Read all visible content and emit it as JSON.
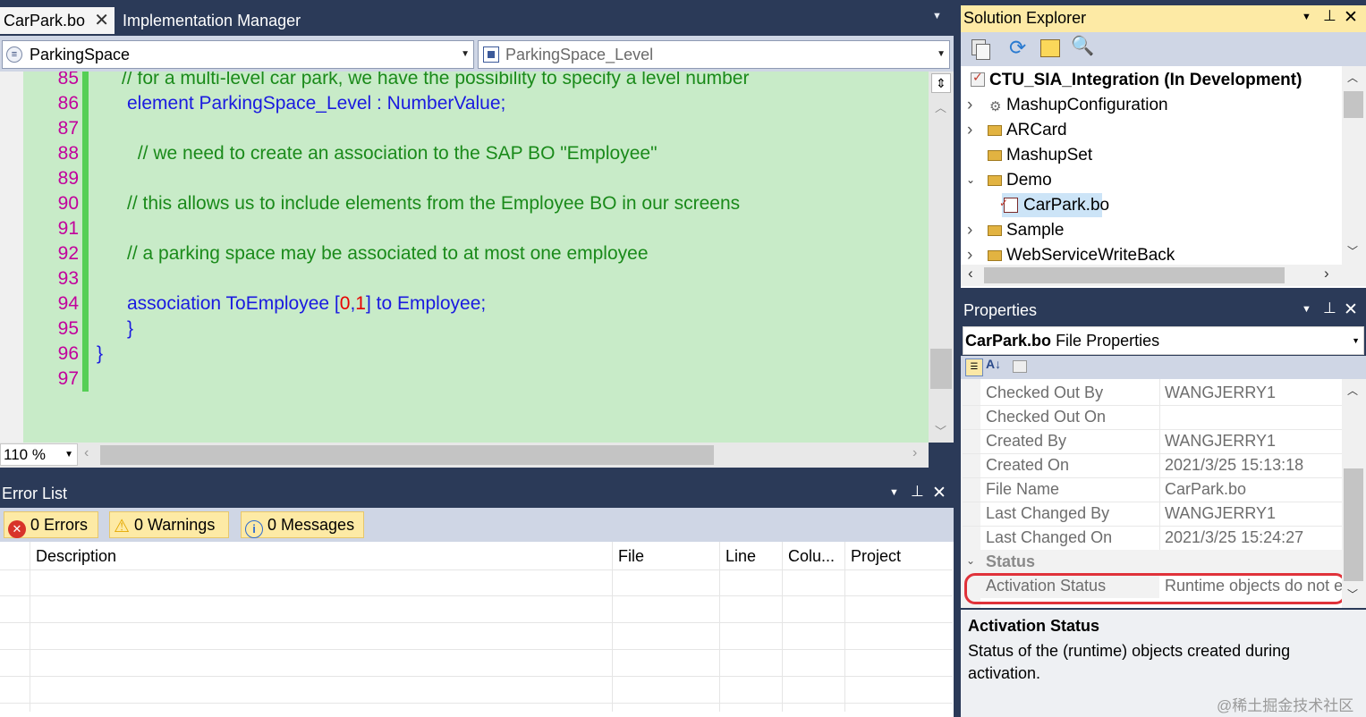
{
  "tabs": [
    {
      "label": "CarPark.bo",
      "active": true
    },
    {
      "label": "Implementation Manager",
      "active": false
    }
  ],
  "editor": {
    "type_dropdown": "ParkingSpace",
    "member_dropdown": "ParkingSpace_Level",
    "zoom": "110 %",
    "lines": [
      {
        "num": "85",
        "parts": [
          {
            "t": "// for a multi-level car park, we have the possibility to specify a level number",
            "c": "cm"
          }
        ]
      },
      {
        "num": "86",
        "parts": [
          {
            "t": "element ParkingSpace_Level : NumberValue;",
            "c": "kw"
          }
        ]
      },
      {
        "num": "87",
        "parts": []
      },
      {
        "num": "88",
        "parts": [
          {
            "t": " // we need to create an association to the SAP BO \"Employee\"",
            "c": "cm"
          }
        ]
      },
      {
        "num": "89",
        "parts": []
      },
      {
        "num": "90",
        "parts": [
          {
            "t": "// this allows us to include elements from the Employee BO in our screens",
            "c": "cm"
          }
        ]
      },
      {
        "num": "91",
        "parts": []
      },
      {
        "num": "92",
        "parts": [
          {
            "t": "// a parking space may be associated to at most one employee",
            "c": "cm"
          }
        ]
      },
      {
        "num": "93",
        "parts": []
      },
      {
        "num": "94",
        "parts": [
          {
            "t": "association ToEmployee [",
            "c": "kw"
          },
          {
            "t": "0",
            "c": "num"
          },
          {
            "t": ",",
            "c": "kw"
          },
          {
            "t": "1",
            "c": "num"
          },
          {
            "t": "] to Employee;",
            "c": "kw"
          }
        ]
      },
      {
        "num": "95",
        "parts": [
          {
            "t": "}",
            "c": "kw"
          }
        ]
      },
      {
        "num": "96",
        "parts": [
          {
            "t": "}",
            "c": "kw"
          }
        ]
      },
      {
        "num": "97",
        "parts": []
      }
    ]
  },
  "error_list": {
    "title": "Error List",
    "errors_btn": "0 Errors",
    "warnings_btn": "0 Warnings",
    "messages_btn": "0 Messages",
    "columns": [
      "Description",
      "File",
      "Line",
      "Colu...",
      "Project"
    ]
  },
  "solution_explorer": {
    "title": "Solution Explorer",
    "root": "CTU_SIA_Integration (In Development)",
    "items": [
      {
        "label": "MashupConfiguration"
      },
      {
        "label": "ARCard"
      },
      {
        "label": "MashupSet"
      },
      {
        "label": "Demo"
      },
      {
        "label": "CarPark.bo"
      },
      {
        "label": "Sample"
      },
      {
        "label": "WebServiceWriteBack"
      }
    ]
  },
  "properties": {
    "title": "Properties",
    "object_name": "CarPark.bo",
    "object_type": "File Properties",
    "rows": [
      {
        "name": "Checked Out By",
        "value": "WANGJERRY1"
      },
      {
        "name": "Checked Out On",
        "value": ""
      },
      {
        "name": "Created By",
        "value": "WANGJERRY1"
      },
      {
        "name": "Created On",
        "value": "2021/3/25 15:13:18"
      },
      {
        "name": "File Name",
        "value": "CarPark.bo"
      },
      {
        "name": "Last Changed By",
        "value": "WANGJERRY1"
      },
      {
        "name": "Last Changed On",
        "value": "2021/3/25 15:24:27"
      }
    ],
    "category": "Status",
    "status_row": {
      "name": "Activation Status",
      "value": "Runtime objects do not e"
    },
    "desc_title": "Activation Status",
    "desc_text": "Status of the (runtime) objects created during activation."
  },
  "watermark": "@稀土掘金技术社区",
  "colors": {
    "accent_highlight": "#e0323a",
    "editor_bg": "#c8ebc8",
    "frame": "#2b3a58"
  }
}
